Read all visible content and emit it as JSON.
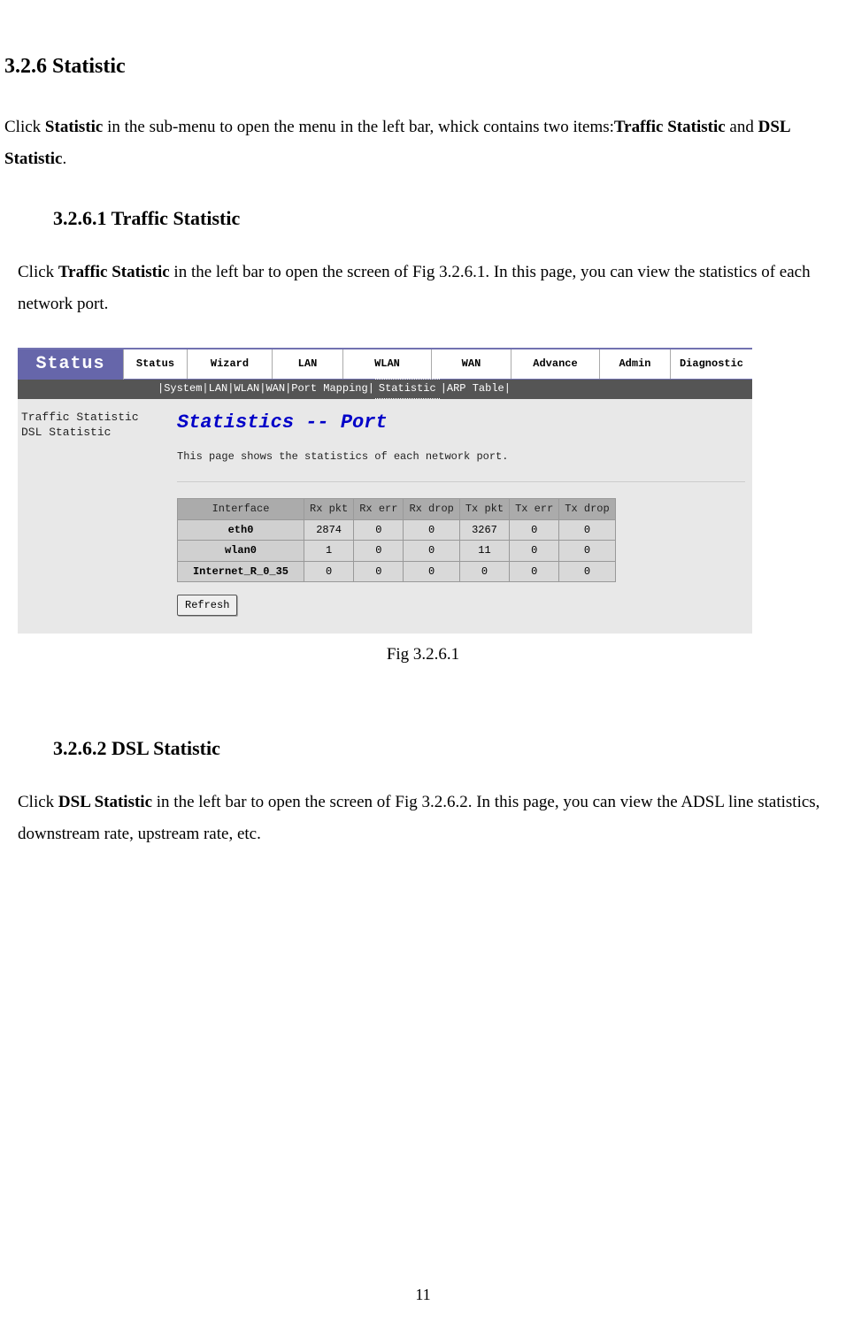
{
  "doc": {
    "h_3_2_6": "3.2.6 Statistic",
    "p1_pre": "Click ",
    "p1_b1": "Statistic",
    "p1_mid": " in the sub-menu to open the menu in the left bar, whick contains two items:",
    "p1_b2": "Traffic Statistic",
    "p1_and": " and ",
    "p1_b3": "DSL Statistic",
    "p1_end": ".",
    "h_3_2_6_1": "3.2.6.1 Traffic Statistic",
    "p2_pre": "Click ",
    "p2_b1": "Traffic Statistic",
    "p2_post": " in the left bar to open the screen of Fig 3.2.6.1. In this page, you can view the statistics of each network port.",
    "fig1_caption": "Fig 3.2.6.1",
    "h_3_2_6_2": "3.2.6.2 DSL Statistic",
    "p3_pre": "Click ",
    "p3_b1": "DSL Statistic",
    "p3_post": " in the left bar to open the screen of Fig 3.2.6.2. In this page, you can view the ADSL line statistics, downstream rate, upstream rate, etc.",
    "page_number": "11"
  },
  "ui": {
    "status_label": "Status",
    "tabs": {
      "status": "Status",
      "wizard": "Wizard",
      "lan": "LAN",
      "wlan": "WLAN",
      "wan": "WAN",
      "advance": "Advance",
      "admin": "Admin",
      "diagnostic": "Diagnostic"
    },
    "subnav": {
      "system": "System",
      "lan": "LAN",
      "wlan": "WLAN",
      "wan": "WAN",
      "port_mapping": "Port Mapping",
      "statistic": "Statistic",
      "arp_table": "ARP Table"
    },
    "sidebar": {
      "item0": "Traffic Statistic",
      "item1": "DSL Statistic"
    },
    "main": {
      "title": "Statistics -- Port",
      "desc": "This page shows the statistics of each network port.",
      "refresh_label": "Refresh"
    },
    "table": {
      "headers": {
        "iface": "Interface",
        "rx_pkt": "Rx pkt",
        "rx_err": "Rx err",
        "rx_drop": "Rx drop",
        "tx_pkt": "Tx pkt",
        "tx_err": "Tx err",
        "tx_drop": "Tx drop"
      },
      "rows": [
        {
          "iface": "eth0",
          "rx_pkt": "2874",
          "rx_err": "0",
          "rx_drop": "0",
          "tx_pkt": "3267",
          "tx_err": "0",
          "tx_drop": "0"
        },
        {
          "iface": "wlan0",
          "rx_pkt": "1",
          "rx_err": "0",
          "rx_drop": "0",
          "tx_pkt": "11",
          "tx_err": "0",
          "tx_drop": "0"
        },
        {
          "iface": "Internet_R_0_35",
          "rx_pkt": "0",
          "rx_err": "0",
          "rx_drop": "0",
          "tx_pkt": "0",
          "tx_err": "0",
          "tx_drop": "0"
        }
      ]
    }
  }
}
